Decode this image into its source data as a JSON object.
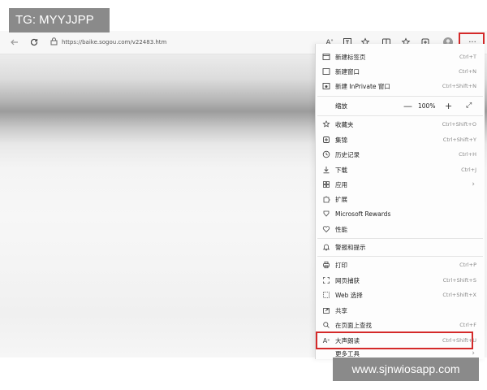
{
  "watermark_top": "TG: MYYJJPP",
  "watermark_bottom": "www.sjnwiosapp.com",
  "address_bar": {
    "url": "https://baike.sogou.com/v22483.htm"
  },
  "toolbar": {
    "more_label": "···"
  },
  "menu": {
    "new_tab": {
      "label": "新建标签页",
      "shortcut": "Ctrl+T"
    },
    "new_window": {
      "label": "新建窗口",
      "shortcut": "Ctrl+N"
    },
    "new_inprivate": {
      "label": "新建 InPrivate 窗口",
      "shortcut": "Ctrl+Shift+N"
    },
    "zoom": {
      "label": "缩放",
      "minus": "—",
      "value": "100%",
      "plus": "+",
      "fullscreen": "⤢"
    },
    "favorites": {
      "label": "收藏夹",
      "shortcut": "Ctrl+Shift+O"
    },
    "collections": {
      "label": "集锦",
      "shortcut": "Ctrl+Shift+Y"
    },
    "history": {
      "label": "历史记录",
      "shortcut": "Ctrl+H"
    },
    "downloads": {
      "label": "下载",
      "shortcut": "Ctrl+J"
    },
    "apps": {
      "label": "应用",
      "arrow": "›"
    },
    "extensions": {
      "label": "扩展"
    },
    "rewards": {
      "label": "Microsoft Rewards"
    },
    "performance": {
      "label": "性能"
    },
    "alerts": {
      "label": "警报和提示"
    },
    "print": {
      "label": "打印",
      "shortcut": "Ctrl+P"
    },
    "web_capture": {
      "label": "网页捕获",
      "shortcut": "Ctrl+Shift+S"
    },
    "web_select": {
      "label": "Web 选择",
      "shortcut": "Ctrl+Shift+X"
    },
    "share": {
      "label": "共享"
    },
    "find": {
      "label": "在页面上查找",
      "shortcut": "Ctrl+F"
    },
    "read_aloud": {
      "label": "大声朗读",
      "shortcut": "Ctrl+Shift+U"
    },
    "more_tools": {
      "label": "更多工具",
      "arrow": "›"
    }
  },
  "colors": {
    "highlight": "#d42a2a",
    "watermark_bg": "#8a8a8a"
  }
}
